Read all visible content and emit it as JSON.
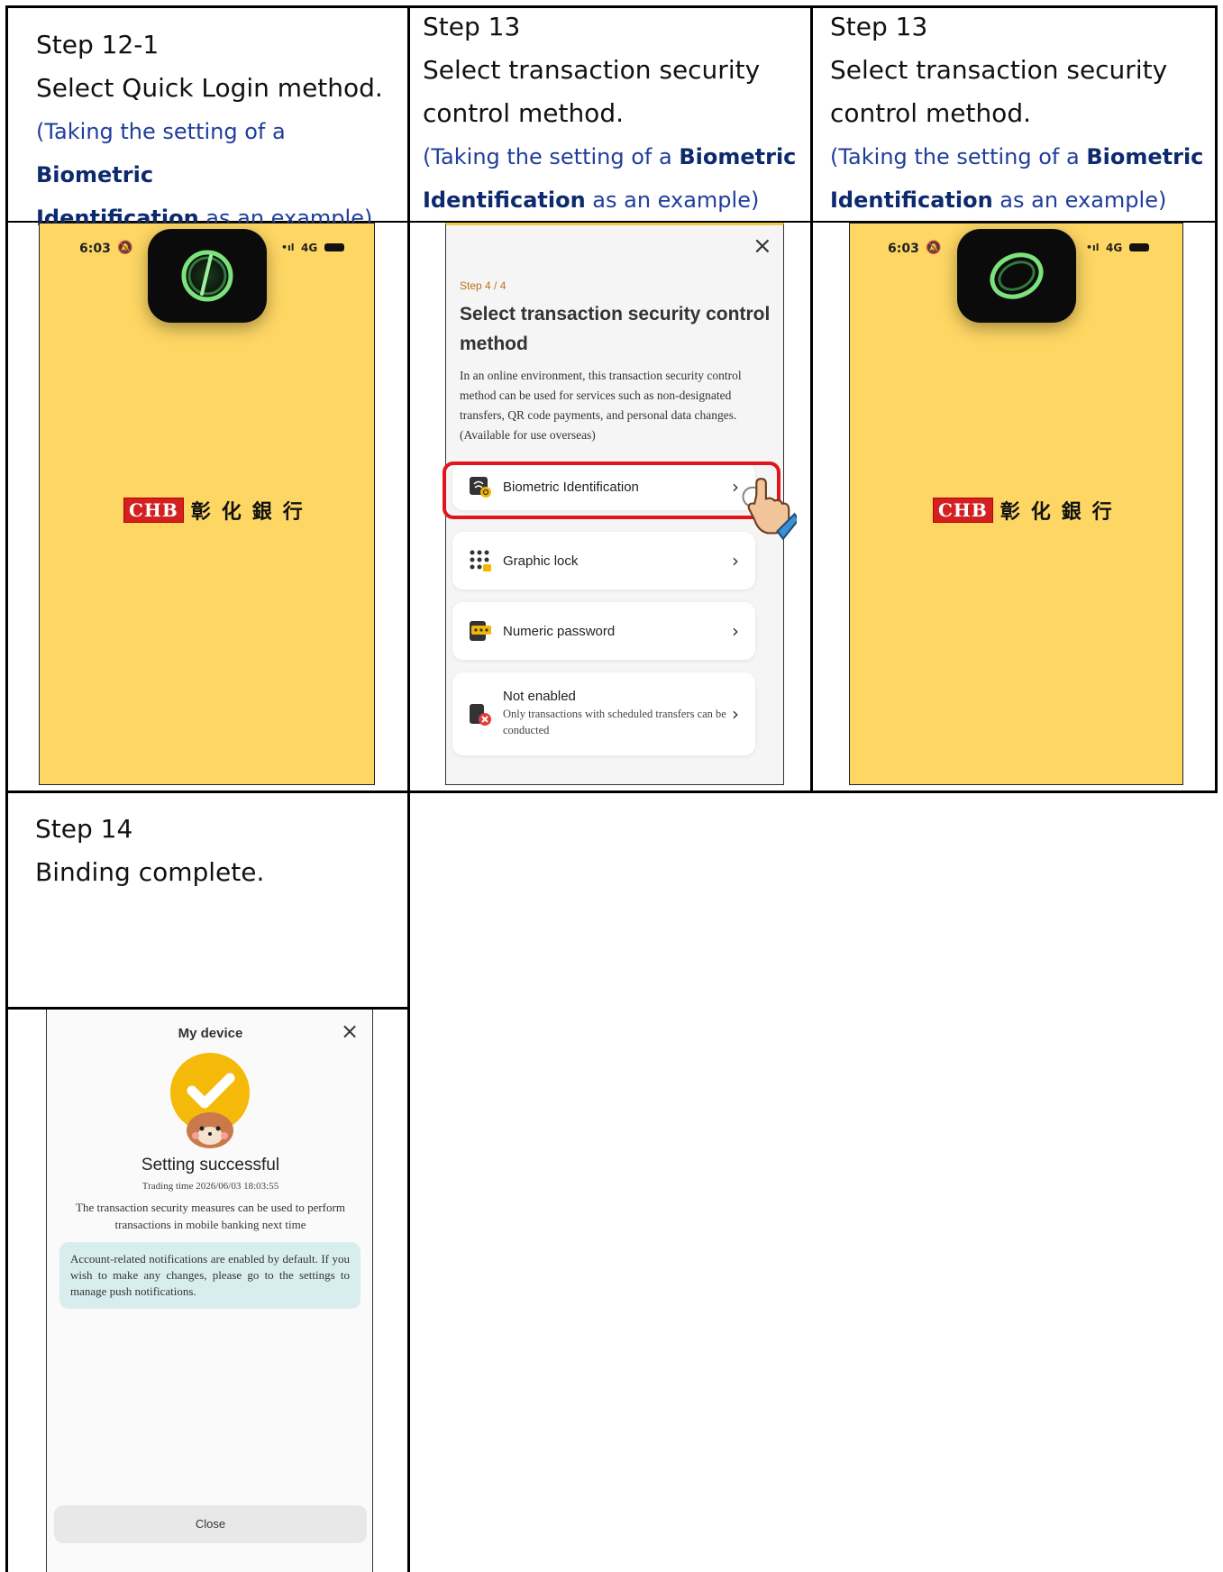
{
  "cells": {
    "step12": {
      "title": "Step 12-1",
      "line1": "Select Quick Login method.",
      "note_pre": "(Taking the setting of a ",
      "note_bold1": "Biometric",
      "note_bold2": "Identification",
      "note_post": " as an example)"
    },
    "step13a": {
      "title": "Step 13",
      "line1": "Select transaction security",
      "line2": "control method.",
      "note_pre": "(Taking the setting of a ",
      "note_bold1": "Biometric",
      "note_bold2": "Identification",
      "note_post": " as an example)"
    },
    "step13b": {
      "title": "Step 13",
      "line1": "Select transaction security",
      "line2": "control method.",
      "note_pre": "(Taking the setting of a ",
      "note_bold1": "Biometric",
      "note_bold2": "Identification",
      "note_post": " as an example)"
    },
    "step14": {
      "title": "Step 14",
      "line1": "Binding complete."
    }
  },
  "splash": {
    "time": "6:03",
    "network": "4G",
    "logo_latin": "CHB",
    "logo_chinese": "彰化銀行"
  },
  "security_screen": {
    "step_indicator": "Step 4 / 4",
    "heading": "Select transaction security control method",
    "description": "In an online environment, this transaction security control method can be used for services such as non-designated transfers, QR code payments, and personal data changes. (Available for use overseas)",
    "options": [
      {
        "label": "Biometric Identification",
        "icon": "fingerprint-icon",
        "highlighted": true
      },
      {
        "label": "Graphic lock",
        "icon": "dot-grid-lock-icon"
      },
      {
        "label": "Numeric password",
        "icon": "password-icon"
      },
      {
        "label": "Not enabled",
        "sub": "Only transactions with scheduled transfers can be conducted",
        "icon": "disabled-icon"
      }
    ],
    "close_symbol": "×",
    "chevron": "›"
  },
  "device_screen": {
    "title": "My device",
    "close_symbol": "×",
    "success_title": "Setting successful",
    "trading_time": "Trading time 2026/06/03 18:03:55",
    "message": "The transaction security measures can be used to perform transactions in mobile banking next time",
    "notice": "Account-related notifications are enabled by default. If you wish to make any changes, please go to the settings to manage push notifications.",
    "close_button": "Close"
  },
  "colors": {
    "splash_yellow": "#fdd663",
    "note_blue": "#1f3e9c",
    "highlight_red": "#e3141b",
    "step_orange": "#c0701a",
    "notice_bg": "#d8eeee"
  }
}
